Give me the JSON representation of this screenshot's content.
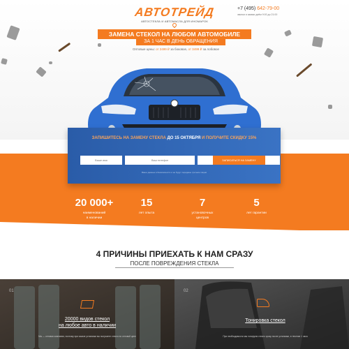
{
  "brand": {
    "logo": "АВТОТРЕЙД",
    "tagline": "АВТОСТЕКЛА И АВТОМАСЛА ДЛЯ ИНОМАРОК"
  },
  "contact": {
    "phone_code": "+7 (495)",
    "phone_number": "642-79-00",
    "hours": "звонки и заявки днём 9:00 до 21:00"
  },
  "hero": {
    "headline": "ЗАМЕНА СТЕКОЛ НА ЛЮБОМ АВТОМОБИЛЕ",
    "subhead": "ЗА 1 ЧАС В ДЕНЬ ОБРАЩЕНИЯ",
    "prices_prefix": "Оптовые цены:",
    "price_side": "от 2499 ₽",
    "price_side_label": "за боковое,",
    "price_front": "от 3499 ₽",
    "price_front_label": "за лобовое"
  },
  "form": {
    "title_part1": "ЗАПИШИТЕСЬ НА ЗАМЕНУ СТЕКЛА",
    "title_part2": "ДО 15 ОКТЯБРЯ",
    "title_part3": "И ПОЛУЧИТЕ СКИДКУ 15%",
    "name_placeholder": "Ваше имя",
    "phone_placeholder": "Ваш телефон",
    "car_placeholder": "Марка и модель авто",
    "submit_label": "ЗАПИСАТЬСЯ НА ЗАМЕНУ",
    "note": "Ваши данные в безопасности и не будут переданы третьим лицам"
  },
  "stats": [
    {
      "value": "20 000+",
      "label1": "наименований",
      "label2": "в наличии"
    },
    {
      "value": "15",
      "label1": "лет опыта",
      "label2": ""
    },
    {
      "value": "7",
      "label1": "установочных",
      "label2": "центров"
    },
    {
      "value": "5",
      "label1": "лет гарантии",
      "label2": ""
    }
  ],
  "reasons": {
    "title": "4 ПРИЧИНЫ ПРИЕХАТЬ К НАМ СРАЗУ",
    "subtitle": "ПОСЛЕ ПОВРЕЖДЕНИЯ СТЕКЛА"
  },
  "panels": [
    {
      "num": "01",
      "title1": "20000 видов стекол",
      "title2": "на любое авто в наличии",
      "desc": "Мы — оптовая компания, поэтому при заказе установки вы получаете стекло по оптовой цене"
    },
    {
      "num": "02",
      "title1": "Тонировка стекол",
      "title2": "",
      "desc": "При необходимости мы тонируем стекло сразу после установки, в течение 1 часа"
    }
  ],
  "colors": {
    "accent": "#f47b20",
    "form_blue": "#2a5ca8",
    "dark": "#2b2b2b"
  }
}
